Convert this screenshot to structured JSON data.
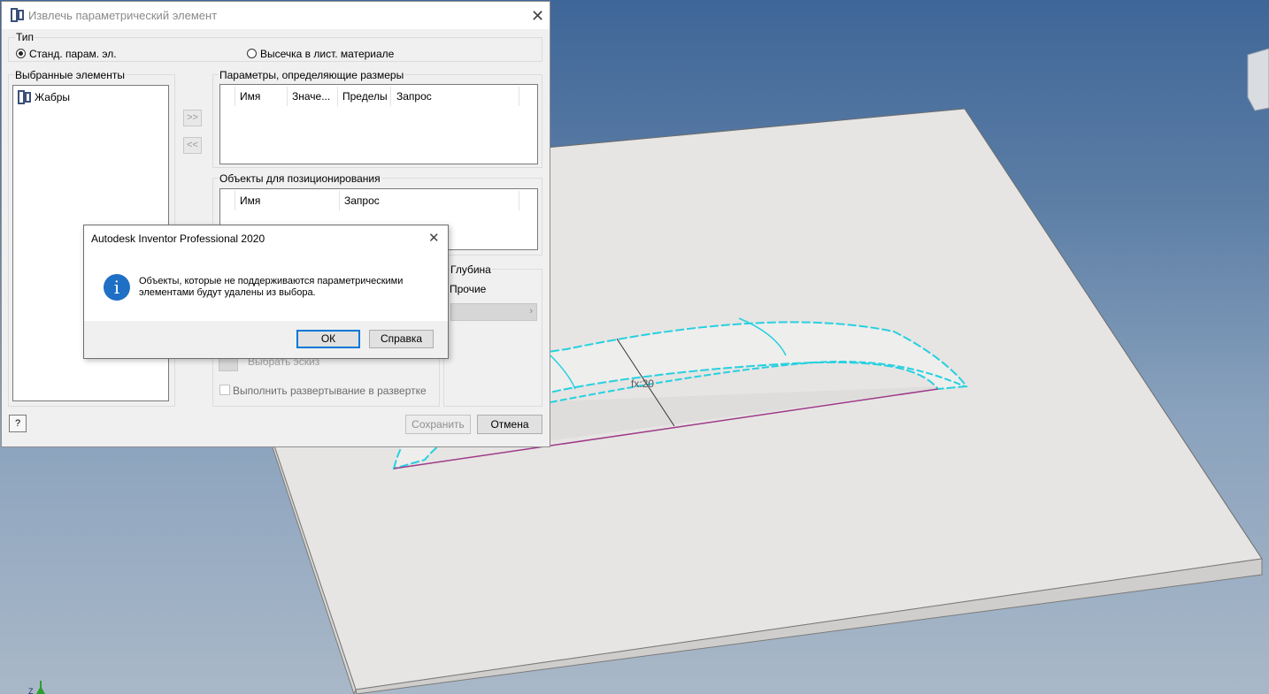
{
  "viewport": {
    "dimension_label": "fx:20",
    "axis_label": "Z"
  },
  "dialog": {
    "title": "Извлечь параметрический элемент",
    "type_group": {
      "label": "Тип",
      "option_standard": "Станд. парам. эл.",
      "option_punch": "Высечка в лист. материале",
      "selected": "option_standard"
    },
    "selected_elements": {
      "label": "Выбранные элементы",
      "items": [
        "Жабры"
      ]
    },
    "move_right_label": ">>",
    "move_left_label": "<<",
    "size_params": {
      "label": "Параметры, определяющие размеры",
      "columns": [
        "Имя",
        "Значе...",
        "Пределы",
        "Запрос"
      ]
    },
    "positioning": {
      "label": "Объекты для позиционирования",
      "columns": [
        "Имя",
        "Запрос"
      ]
    },
    "depth": {
      "label": "Глубина",
      "value": "Прочие"
    },
    "select_sketch_label": "Выбрать эскиз",
    "unfold_checkbox_label": "Выполнить развертывание в развертке",
    "unfold_checked": false,
    "save_label": "Сохранить",
    "cancel_label": "Отмена",
    "help_icon": "help-icon"
  },
  "message_box": {
    "title": "Autodesk Inventor Professional 2020",
    "line1": "Объекты, которые не поддерживаются параметрическими",
    "line2": "элементами будут удалены из выбора.",
    "ok_label": "ОК",
    "help_label": "Справка",
    "icon": "info-icon"
  },
  "colors": {
    "accent": "#0078d7",
    "edge_cyan": "#27d0e0",
    "edge_magenta": "#a03a8a",
    "plate": "#e6e5e3"
  }
}
